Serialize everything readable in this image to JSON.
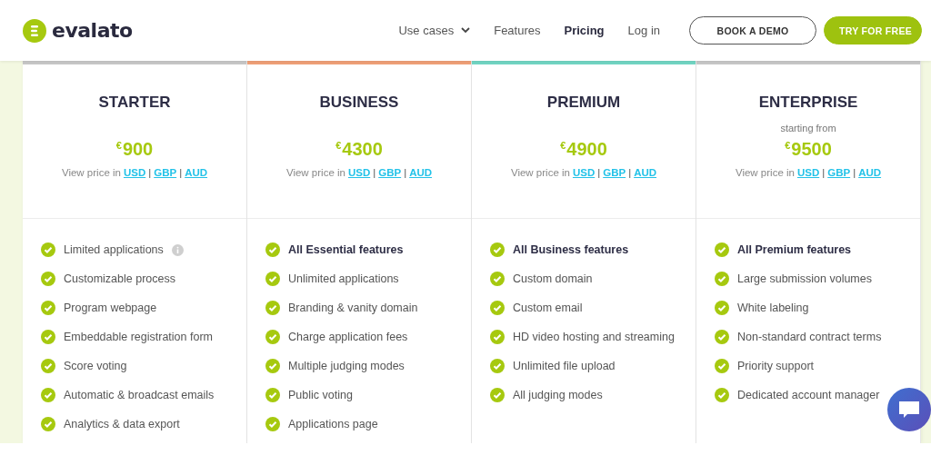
{
  "header": {
    "logo": "evalato",
    "nav": [
      {
        "label": "Use cases",
        "dropdown": true,
        "selected": false
      },
      {
        "label": "Features",
        "dropdown": false,
        "selected": false
      },
      {
        "label": "Pricing",
        "dropdown": false,
        "selected": true
      },
      {
        "label": "Log in",
        "dropdown": false,
        "selected": false
      }
    ],
    "buttons": [
      {
        "label": "BOOK A DEMO",
        "kind": "outline"
      },
      {
        "label": "TRY FOR FREE",
        "kind": "filled"
      }
    ]
  },
  "plans": [
    {
      "name": "STARTER",
      "color": "#c8c8c8",
      "currency": "€",
      "price": "900",
      "view_label": "View price in",
      "currencies": [
        "USD",
        "GBP",
        "AUD"
      ],
      "separator": "|",
      "features": [
        {
          "text": "Limited applications",
          "bold": false,
          "info": true
        },
        {
          "text": "Customizable process",
          "bold": false,
          "info": false
        },
        {
          "text": "Program webpage",
          "bold": false,
          "info": false
        },
        {
          "text": "Embeddable registration form",
          "bold": false,
          "info": false
        },
        {
          "text": "Score voting",
          "bold": false,
          "info": false
        },
        {
          "text": "Automatic & broadcast emails",
          "bold": false,
          "info": false
        },
        {
          "text": "Analytics & data export",
          "bold": false,
          "info": false
        }
      ]
    },
    {
      "name": "BUSINESS",
      "color": "#f0a078",
      "currency": "€",
      "price": "4300",
      "view_label": "View price in",
      "currencies": [
        "USD",
        "GBP",
        "AUD"
      ],
      "separator": "|",
      "features": [
        {
          "text": "All Essential features",
          "bold": true,
          "info": false
        },
        {
          "text": "Unlimited applications",
          "bold": false,
          "info": false
        },
        {
          "text": "Branding & vanity domain",
          "bold": false,
          "info": false
        },
        {
          "text": "Charge application fees",
          "bold": false,
          "info": false
        },
        {
          "text": "Multiple judging modes",
          "bold": false,
          "info": false
        },
        {
          "text": "Public voting",
          "bold": false,
          "info": false
        },
        {
          "text": "Applications page",
          "bold": false,
          "info": false
        }
      ]
    },
    {
      "name": "PREMIUM",
      "color": "#72d6c4",
      "currency": "€",
      "price": "4900",
      "view_label": "View price in",
      "currencies": [
        "USD",
        "GBP",
        "AUD"
      ],
      "separator": "|",
      "features": [
        {
          "text": "All Business features",
          "bold": true,
          "info": false
        },
        {
          "text": "Custom domain",
          "bold": false,
          "info": false
        },
        {
          "text": "Custom email",
          "bold": false,
          "info": false
        },
        {
          "text": "HD video hosting and streaming",
          "bold": false,
          "info": false
        },
        {
          "text": "Unlimited file upload",
          "bold": false,
          "info": false
        },
        {
          "text": "All judging modes",
          "bold": false,
          "info": false
        }
      ]
    },
    {
      "name": "ENTERPRISE",
      "color": "#c8c8c8",
      "note": "starting from",
      "currency": "€",
      "price": "9500",
      "view_label": "View price in",
      "currencies": [
        "USD",
        "GBP",
        "AUD"
      ],
      "separator": "|",
      "features": [
        {
          "text": "All Premium features",
          "bold": true,
          "info": false
        },
        {
          "text": "Large submission volumes",
          "bold": false,
          "info": false
        },
        {
          "text": "White labeling",
          "bold": false,
          "info": false
        },
        {
          "text": "Non-standard contract terms",
          "bold": false,
          "info": false
        },
        {
          "text": "Priority support",
          "bold": false,
          "info": false
        },
        {
          "text": "Dedicated account manager",
          "bold": false,
          "info": false
        }
      ]
    }
  ]
}
